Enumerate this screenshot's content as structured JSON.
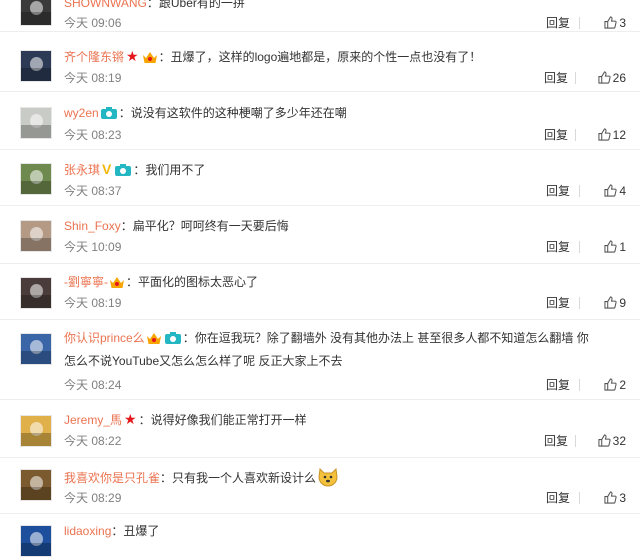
{
  "labels": {
    "reply": "回复"
  },
  "comments": [
    {
      "user": "SHOWNWANG",
      "content": "：跟Uber有的一拼",
      "time": "今天 09:06",
      "likes": "3",
      "avatar_color": "#3a3a3a"
    },
    {
      "user": "齐个隆东锵",
      "content": "：丑爆了，这样的logo遍地都是，原来的个性一点也没有了！",
      "time": "今天 08:19",
      "likes": "26",
      "avatar_color": "#2d3a55"
    },
    {
      "user": "wy2en",
      "content": "：说没有这软件的这种梗嘲了多少年还在嘲",
      "time": "今天 08:23",
      "likes": "12",
      "avatar_color": "#c9cbc6"
    },
    {
      "user": "张永琪",
      "content": "：我们用不了",
      "time": "今天 08:37",
      "likes": "4",
      "avatar_color": "#6f8a4f"
    },
    {
      "user": "Shin_Foxy",
      "content": "：扁平化？呵呵终有一天要后悔",
      "time": "今天 10:09",
      "likes": "1",
      "avatar_color": "#b49a85"
    },
    {
      "user": "-劉寧寧-",
      "content": "：平面化的图标太恶心了",
      "time": "今天 08:19",
      "likes": "9",
      "avatar_color": "#4a3c3a"
    },
    {
      "user": "你认识prince么",
      "content": "：你在逗我玩？除了翻墙外 没有其他办法上 甚至很多人都不知道怎么翻墙 你",
      "content2": "怎么不说YouTube又怎么怎么样了呢 反正大家上不去",
      "time": "今天 08:24",
      "likes": "2",
      "avatar_color": "#3a66a8"
    },
    {
      "user": "Jeremy_馬",
      "content": "：说得好像我们能正常打开一样",
      "time": "今天 08:22",
      "likes": "32",
      "avatar_color": "#e0b04a"
    },
    {
      "user": "我喜欢你是只孔雀",
      "content": "：只有我一个人喜欢新设计么",
      "time": "今天 08:29",
      "likes": "3",
      "avatar_color": "#7a5a2e"
    },
    {
      "user": "lidaoxing",
      "content": "：丑爆了",
      "avatar_color": "#1d4f9c"
    }
  ]
}
